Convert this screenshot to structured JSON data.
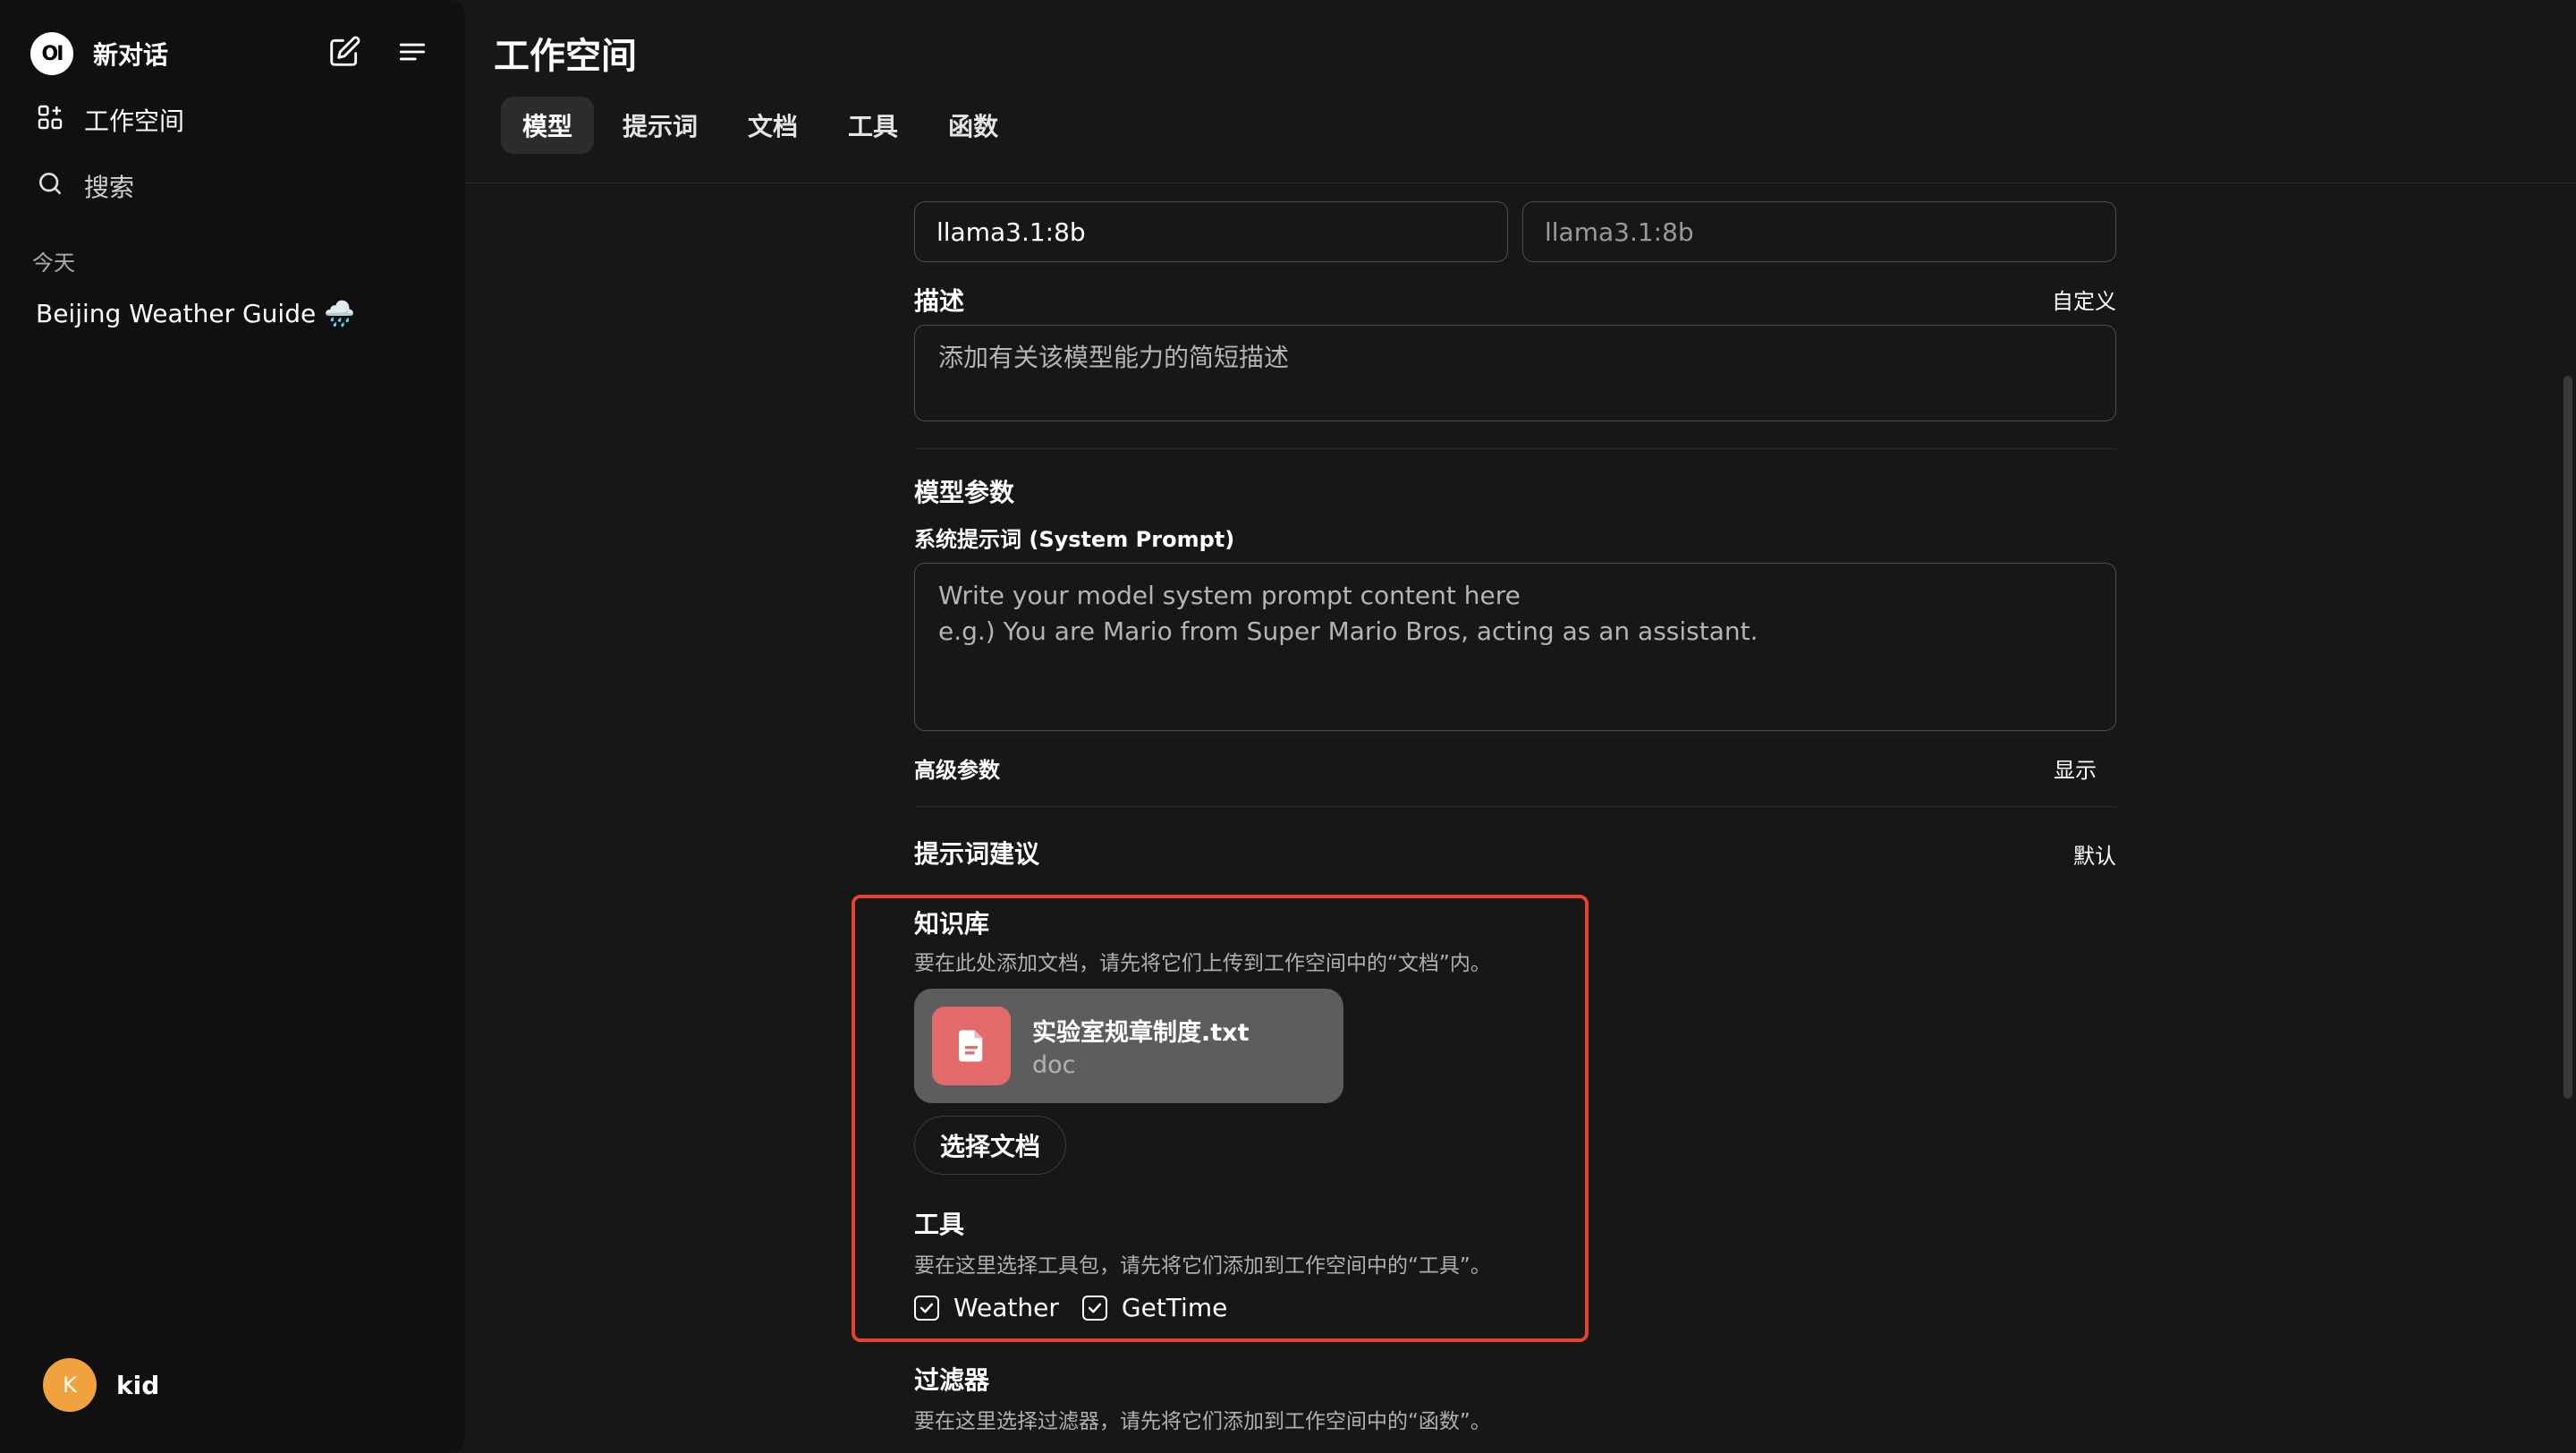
{
  "sidebar": {
    "logo_text": "OI",
    "new_chat": "新对话",
    "workspace": "工作空间",
    "search": "搜索",
    "section_today": "今天",
    "chats": [
      "Beijing Weather Guide 🌧️"
    ],
    "user": {
      "initial": "K",
      "name": "kid"
    }
  },
  "header": {
    "title": "工作空间",
    "tabs": [
      "模型",
      "提示词",
      "文档",
      "工具",
      "函数"
    ],
    "active_tab": "模型"
  },
  "form": {
    "model_name_value": "llama3.1:8b",
    "model_id_placeholder": "llama3.1:8b",
    "description_label": "描述",
    "description_action": "自定义",
    "description_placeholder": "添加有关该模型能力的简短描述",
    "params_label": "模型参数",
    "system_prompt_label": "系统提示词 (System Prompt)",
    "system_prompt_placeholder": "Write your model system prompt content here\ne.g.) You are Mario from Super Mario Bros, acting as an assistant.",
    "advanced_label": "高级参数",
    "advanced_action": "显示",
    "suggestions_label": "提示词建议",
    "suggestions_action": "默认",
    "knowledge_label": "知识库",
    "knowledge_hint": "要在此处添加文档，请先将它们上传到工作空间中的“文档”内。",
    "knowledge_doc": {
      "name": "实验室规章制度.txt",
      "type": "doc"
    },
    "select_doc_button": "选择文档",
    "tools_label": "工具",
    "tools_hint": "要在这里选择工具包，请先将它们添加到工作空间中的“工具”。",
    "tools": [
      {
        "name": "Weather",
        "checked": true
      },
      {
        "name": "GetTime",
        "checked": true
      }
    ],
    "filters_label": "过滤器",
    "filters_hint": "要在这里选择过滤器，请先将它们添加到工作空间中的“函数”。"
  },
  "colors": {
    "accent_highlight": "#e8412f",
    "doc_icon_bg": "#e26a6a",
    "avatar_bg": "#f0a33c"
  }
}
